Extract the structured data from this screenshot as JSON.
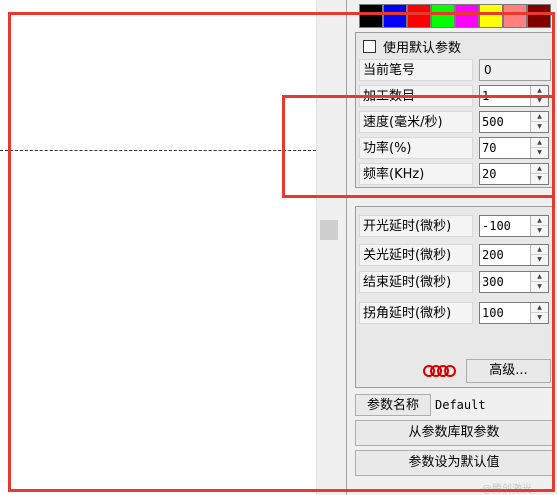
{
  "palette": [
    "#000000",
    "#0000ff",
    "#ff0000",
    "#00ff00",
    "#ff00ff",
    "#ffff00",
    "#ff8080",
    "#800000"
  ],
  "panel": {
    "use_default_label": "使用默认参数",
    "use_default_checked": false,
    "params": [
      {
        "label": "当前笔号",
        "value": "0",
        "editable": false
      },
      {
        "label": "加工数目",
        "value": "1",
        "editable": true
      },
      {
        "label": "速度(毫米/秒)",
        "value": "500",
        "editable": true
      },
      {
        "label": "功率(%)",
        "value": "70",
        "editable": true
      },
      {
        "label": "频率(KHz)",
        "value": "20",
        "editable": true
      }
    ],
    "delays": [
      {
        "label": "开光延时(微秒)",
        "value": "-100"
      },
      {
        "label": "关光延时(微秒)",
        "value": "200"
      },
      {
        "label": "结束延时(微秒)",
        "value": "300"
      },
      {
        "label": "拐角延时(微秒)",
        "value": "100"
      }
    ],
    "advanced_label": "高级...",
    "param_name_label": "参数名称",
    "param_name_value": "Default",
    "load_from_lib_label": "从参数库取参数",
    "set_default_label": "参数设为默认值"
  },
  "watermark": "@腾创激光",
  "highlight_color": "#e8392f"
}
